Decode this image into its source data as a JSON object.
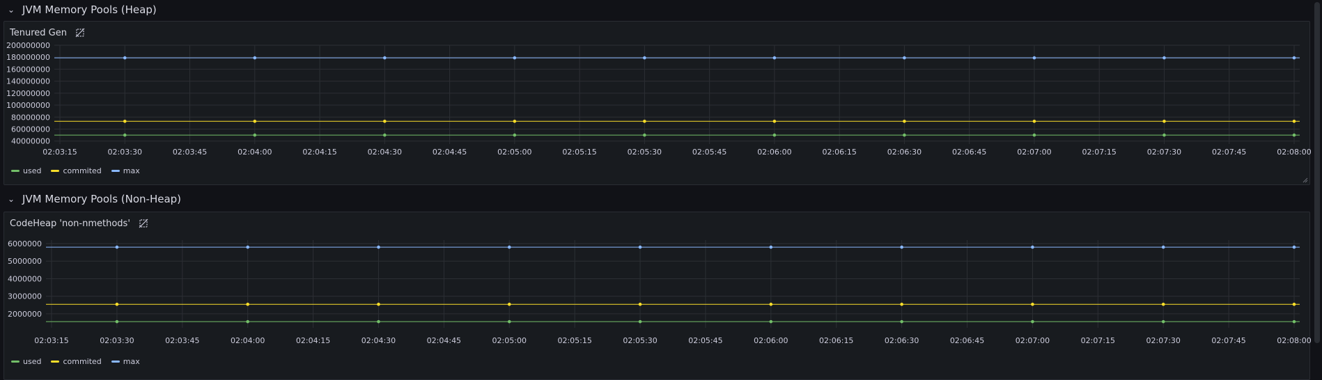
{
  "colors": {
    "used": "#73bf69",
    "commited": "#fade2a",
    "max": "#8ab8ff",
    "grid": "#2c2f34",
    "axis_text": "#ccccdc",
    "panel_bg": "#181b1f",
    "page_bg": "#111217"
  },
  "icons": {
    "row_toggle": "chevron-down-icon",
    "panel_link": "link-off-icon"
  },
  "rows": [
    {
      "title": "JVM Memory Pools (Heap)"
    },
    {
      "title": "JVM Memory Pools (Non-Heap)"
    }
  ],
  "panels": [
    {
      "title": "Tenured Gen",
      "legend": [
        {
          "label": "used"
        },
        {
          "label": "commited"
        },
        {
          "label": "max"
        }
      ]
    },
    {
      "title": "CodeHeap 'non-nmethods'",
      "legend": [
        {
          "label": "used"
        },
        {
          "label": "commited"
        },
        {
          "label": "max"
        }
      ]
    }
  ],
  "chart_data": [
    {
      "type": "line",
      "title": "Tenured Gen",
      "xlabel": "",
      "ylabel": "",
      "grid": true,
      "legend_placement": "bottom-left",
      "x_ticks": [
        "02:03:15",
        "02:03:30",
        "02:03:45",
        "02:04:00",
        "02:04:15",
        "02:04:30",
        "02:04:45",
        "02:05:00",
        "02:05:15",
        "02:05:30",
        "02:05:45",
        "02:06:00",
        "02:06:15",
        "02:06:30",
        "02:06:45",
        "02:07:00",
        "02:07:15",
        "02:07:30",
        "02:07:45",
        "02:08:00"
      ],
      "y_ticks": [
        "40000000",
        "60000000",
        "80000000",
        "100000000",
        "120000000",
        "140000000",
        "160000000",
        "180000000",
        "200000000"
      ],
      "ylim": [
        35000000,
        200000000
      ],
      "x": [
        "02:03:30",
        "02:04:00",
        "02:04:30",
        "02:05:00",
        "02:05:30",
        "02:06:00",
        "02:06:30",
        "02:07:00",
        "02:07:30",
        "02:08:00"
      ],
      "series": [
        {
          "name": "used",
          "values": [
            50000000,
            50000000,
            50000000,
            50000000,
            50000000,
            50000000,
            50000000,
            50000000,
            50000000,
            50000000
          ]
        },
        {
          "name": "commited",
          "values": [
            73000000,
            73000000,
            73000000,
            73000000,
            73000000,
            73000000,
            73000000,
            73000000,
            73000000,
            73000000
          ]
        },
        {
          "name": "max",
          "values": [
            179000000,
            179000000,
            179000000,
            179000000,
            179000000,
            179000000,
            179000000,
            179000000,
            179000000,
            179000000
          ]
        }
      ]
    },
    {
      "type": "line",
      "title": "CodeHeap 'non-nmethods'",
      "xlabel": "",
      "ylabel": "",
      "grid": true,
      "legend_placement": "bottom-left",
      "x_ticks": [
        "02:03:15",
        "02:03:30",
        "02:03:45",
        "02:04:00",
        "02:04:15",
        "02:04:30",
        "02:04:45",
        "02:05:00",
        "02:05:15",
        "02:05:30",
        "02:05:45",
        "02:06:00",
        "02:06:15",
        "02:06:30",
        "02:06:45",
        "02:07:00",
        "02:07:15",
        "02:07:30",
        "02:07:45",
        "02:08:00"
      ],
      "y_ticks": [
        "2000000",
        "3000000",
        "4000000",
        "5000000",
        "6000000"
      ],
      "ylim": [
        1200000,
        6200000
      ],
      "x": [
        "02:03:30",
        "02:04:00",
        "02:04:30",
        "02:05:00",
        "02:05:30",
        "02:06:00",
        "02:06:30",
        "02:07:00",
        "02:07:30",
        "02:08:00"
      ],
      "series": [
        {
          "name": "used",
          "values": [
            1550000,
            1550000,
            1550000,
            1550000,
            1550000,
            1550000,
            1550000,
            1550000,
            1550000,
            1550000
          ]
        },
        {
          "name": "commited",
          "values": [
            2540000,
            2540000,
            2540000,
            2540000,
            2540000,
            2540000,
            2540000,
            2540000,
            2540000,
            2540000
          ]
        },
        {
          "name": "max",
          "values": [
            5800000,
            5800000,
            5800000,
            5800000,
            5800000,
            5800000,
            5800000,
            5800000,
            5800000,
            5800000
          ]
        }
      ]
    }
  ]
}
